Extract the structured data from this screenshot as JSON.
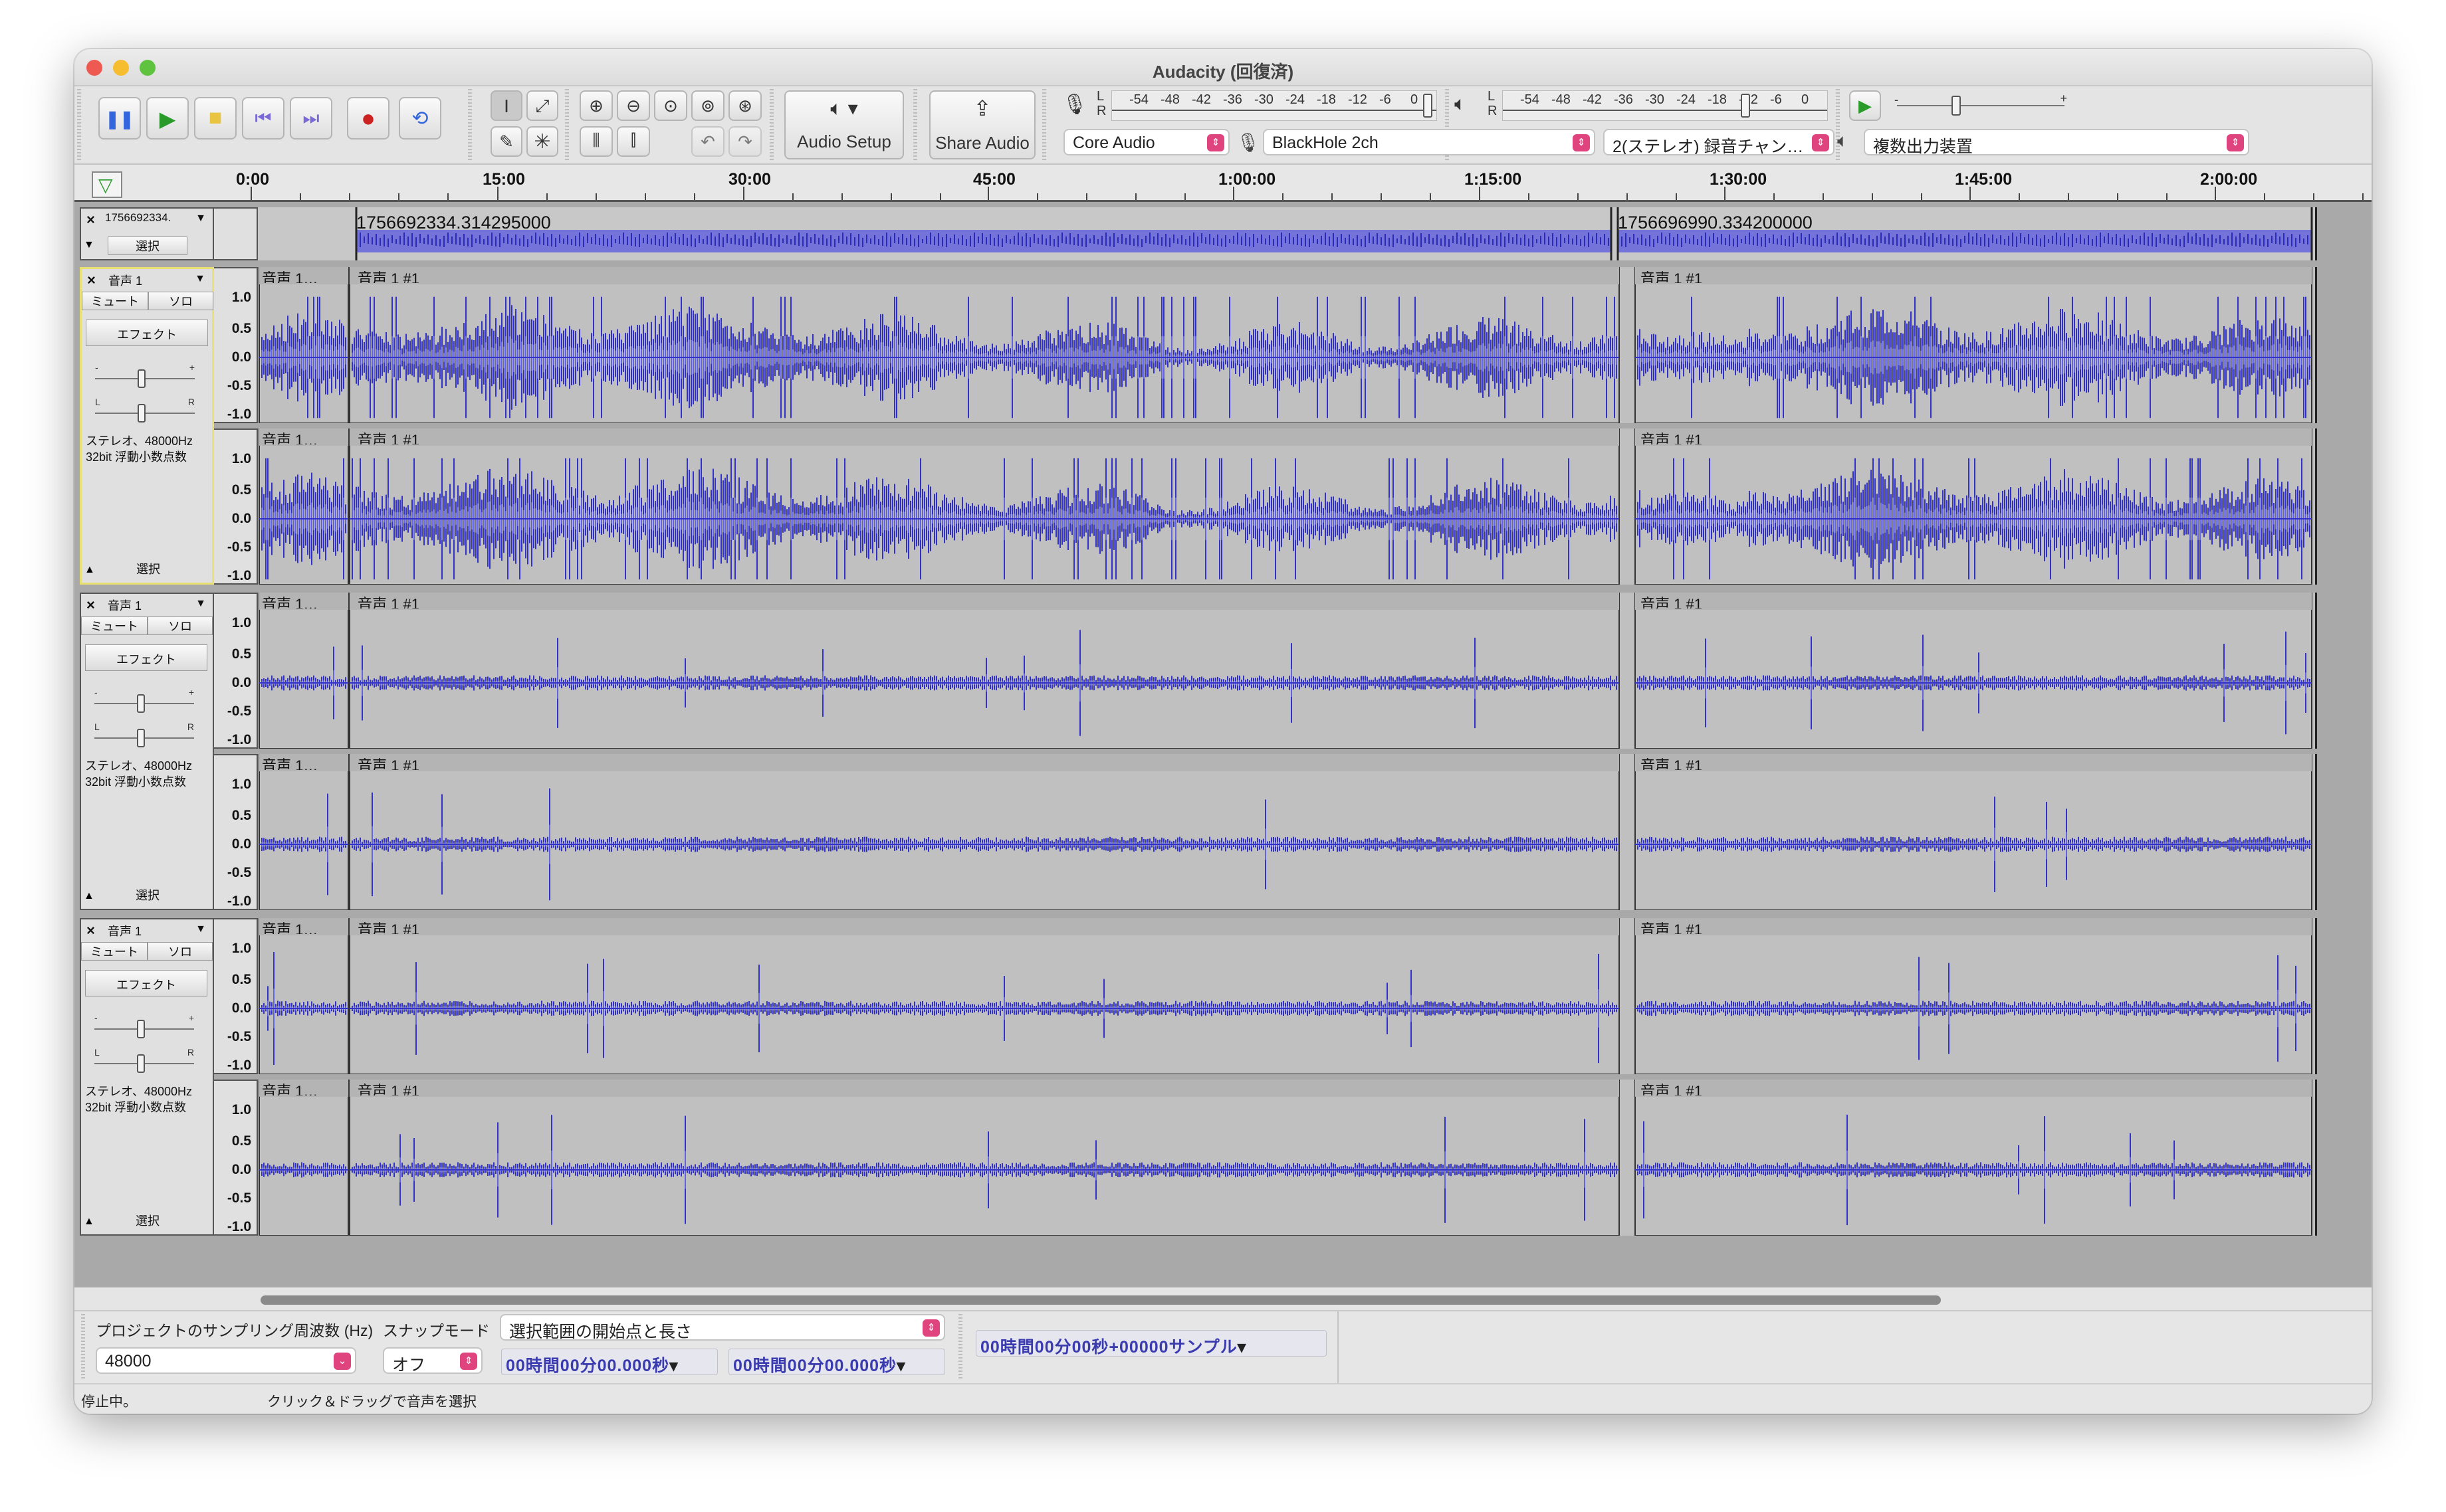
{
  "window": {
    "title": "Audacity (回復済)"
  },
  "toolbar": {
    "audio_setup_label": "Audio Setup",
    "share_audio_label": "Share Audio",
    "host": "Core Audio",
    "recording_device": "BlackHole 2ch",
    "recording_channels": "2(ステレオ) 録音チャン…",
    "playback_device": "複数出力装置",
    "meter_scale": [
      "-54",
      "-48",
      "-42",
      "-36",
      "-30",
      "-24",
      "-18",
      "-12",
      "-6",
      "0"
    ],
    "playback_meter_scale": [
      "-54",
      "-48",
      "-42",
      "-36",
      "-30",
      "-24",
      "-18",
      "-12",
      "-6",
      "0"
    ],
    "meter_lr": [
      "L",
      "R"
    ]
  },
  "ruler": {
    "ticks": [
      "0:00",
      "15:00",
      "30:00",
      "45:00",
      "1:00:00",
      "1:15:00",
      "1:30:00",
      "1:45:00",
      "2:00:00"
    ]
  },
  "label_track": {
    "name": "1756692334.",
    "select_label": "選択",
    "labels": [
      "1756692334.314295000",
      "1756696990.334200000"
    ]
  },
  "tracks": [
    {
      "name": "音声 1",
      "mute_label": "ミュート",
      "solo_label": "ソロ",
      "effects_label": "エフェクト",
      "format_line1": "ステレオ、48000Hz",
      "format_line2": "32bit 浮動小数点数",
      "select_label": "選択",
      "clip_names": [
        "音声 1…",
        "音声 1 #1",
        "音声 1 #1"
      ],
      "scale": [
        "1.0",
        "0.5",
        "0.0",
        "-0.5",
        "-1.0"
      ],
      "amplitude_profile": "loud",
      "selected": true
    },
    {
      "name": "音声 1",
      "mute_label": "ミュート",
      "solo_label": "ソロ",
      "effects_label": "エフェクト",
      "format_line1": "ステレオ、48000Hz",
      "format_line2": "32bit 浮動小数点数",
      "select_label": "選択",
      "clip_names": [
        "音声 1…",
        "音声 1 #1",
        "音声 1 #1"
      ],
      "scale": [
        "1.0",
        "0.5",
        "0.0",
        "-0.5",
        "-1.0"
      ],
      "amplitude_profile": "quiet",
      "selected": false
    },
    {
      "name": "音声 1",
      "mute_label": "ミュート",
      "solo_label": "ソロ",
      "effects_label": "エフェクト",
      "format_line1": "ステレオ、48000Hz",
      "format_line2": "32bit 浮動小数点数",
      "select_label": "選択",
      "clip_names": [
        "音声 1…",
        "音声 1 #1",
        "音声 1 #1"
      ],
      "scale": [
        "1.0",
        "0.5",
        "0.0",
        "-0.5",
        "-1.0"
      ],
      "amplitude_profile": "quiet",
      "selected": false
    }
  ],
  "selection_bar": {
    "rate_label": "プロジェクトのサンプリング周波数 (Hz)",
    "rate_value": "48000",
    "snap_label": "スナップモード",
    "snap_value": "オフ",
    "selection_mode": "選択範囲の開始点と長さ",
    "start_time": "00時間00分00.000秒",
    "length_time": "00時間00分00.000秒",
    "audio_position": "00時間00分00秒+00000サンプル"
  },
  "status_bar": {
    "state": "停止中。",
    "hint": "クリック＆ドラッグで音声を選択"
  },
  "colors": {
    "waveform": "#3232c8",
    "waveform_rms": "#6464dc",
    "lane_bg": "#c0c0c0",
    "record_button": "#cc2222",
    "play_button": "#2a9a2a",
    "selected_track_border": "#e8e070",
    "dropdown_arrow": "#e0447f"
  }
}
